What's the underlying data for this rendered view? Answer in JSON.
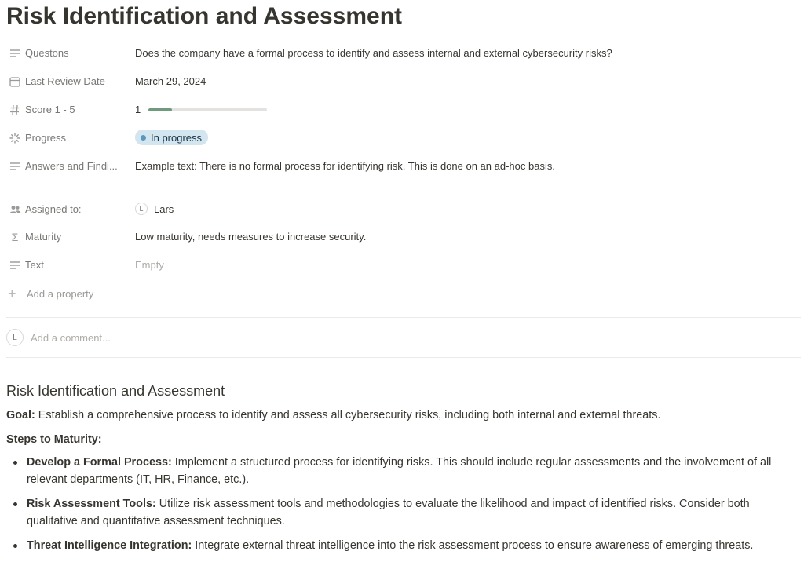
{
  "page": {
    "title": "Risk Identification and Assessment"
  },
  "properties": {
    "questions": {
      "label": "Questons",
      "value": "Does the company have a formal process to identify and assess internal and external cybersecurity risks?",
      "icon": "text-lines-icon"
    },
    "last_review_date": {
      "label": "Last Review Date",
      "value": "March 29, 2024",
      "icon": "calendar-icon"
    },
    "score": {
      "label": "Score 1 - 5",
      "value": "1",
      "fraction": 0.2,
      "icon": "hash-icon",
      "bar_color": "#6f9a7d"
    },
    "progress": {
      "label": "Progress",
      "value": "In progress",
      "icon": "spinner-icon",
      "pill_color": "#d3e5ef",
      "dot_color": "#5b97bd"
    },
    "answers": {
      "label": "Answers and Findi...",
      "value": "Example text: There is no formal process for identifying risk. This is done on an ad-hoc basis.",
      "icon": "text-lines-icon"
    },
    "assigned_to": {
      "label": "Assigned to:",
      "avatar_initial": "L",
      "value": "Lars",
      "icon": "people-icon"
    },
    "maturity": {
      "label": "Maturity",
      "value": "Low maturity, needs measures to increase security.",
      "icon": "sigma-icon"
    },
    "text": {
      "label": "Text",
      "value": "Empty",
      "icon": "text-lines-icon"
    }
  },
  "add_property": {
    "label": "Add a property",
    "icon": "plus-icon"
  },
  "comment": {
    "avatar_initial": "L",
    "placeholder": "Add a comment..."
  },
  "content": {
    "heading": "Risk Identification and Assessment",
    "goal": {
      "label": "Goal:",
      "text": " Establish a comprehensive process to identify and assess all cybersecurity risks, including both internal and external threats."
    },
    "steps_heading": "Steps to Maturity:",
    "steps": [
      {
        "title": "Develop a Formal Process:",
        "text": " Implement a structured process for identifying risks. This should include regular assessments and the involvement of all relevant departments (IT, HR, Finance, etc.)."
      },
      {
        "title": "Risk Assessment Tools:",
        "text": " Utilize risk assessment tools and methodologies to evaluate the likelihood and impact of identified risks. Consider both qualitative and quantitative assessment techniques."
      },
      {
        "title": "Threat Intelligence Integration:",
        "text": " Integrate external threat intelligence into the risk assessment process to ensure awareness of emerging threats."
      }
    ]
  }
}
